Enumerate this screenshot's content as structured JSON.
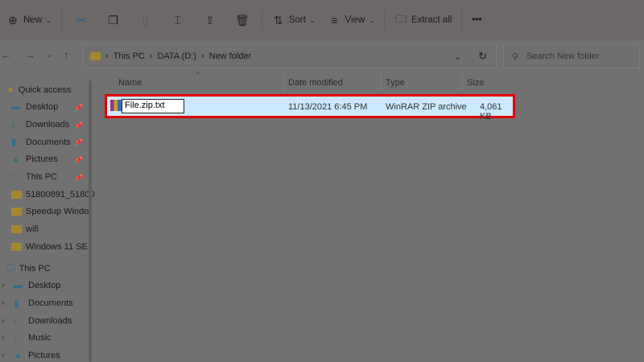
{
  "toolbar": {
    "new": "New",
    "sort": "Sort",
    "view": "View",
    "extract_all": "Extract all",
    "more": "•••"
  },
  "address": {
    "segments": [
      "This PC",
      "DATA (D:)",
      "New folder"
    ],
    "search_placeholder": "Search New folder"
  },
  "sidebar": {
    "quick_access": "Quick access",
    "quick_items": [
      {
        "label": "Desktop",
        "icon": "desktop-icon",
        "pinned": true
      },
      {
        "label": "Downloads",
        "icon": "download-icon",
        "pinned": true
      },
      {
        "label": "Documents",
        "icon": "documents-icon",
        "pinned": true
      },
      {
        "label": "Pictures",
        "icon": "pictures-icon",
        "pinned": true
      },
      {
        "label": "This PC",
        "icon": "pc-icon",
        "pinned": true
      },
      {
        "label": "51800891_51800",
        "icon": "folder-icon"
      },
      {
        "label": "Speedup Windo",
        "icon": "folder-icon"
      },
      {
        "label": "wifi",
        "icon": "folder-icon"
      },
      {
        "label": "Windows 11 SE",
        "icon": "folder-icon"
      }
    ],
    "this_pc": "This PC",
    "pc_items": [
      {
        "label": "Desktop"
      },
      {
        "label": "Documents"
      },
      {
        "label": "Downloads"
      },
      {
        "label": "Music"
      },
      {
        "label": "Pictures"
      }
    ]
  },
  "columns": {
    "name": "Name",
    "date": "Date modified",
    "type": "Type",
    "size": "Size"
  },
  "file": {
    "name": "File.zip.txt",
    "date": "11/13/2021 6:45 PM",
    "type": "WinRAR ZIP archive",
    "size": "4,061 KB"
  },
  "colors": {
    "highlight": "#e00000",
    "selection": "#cce8ff"
  }
}
